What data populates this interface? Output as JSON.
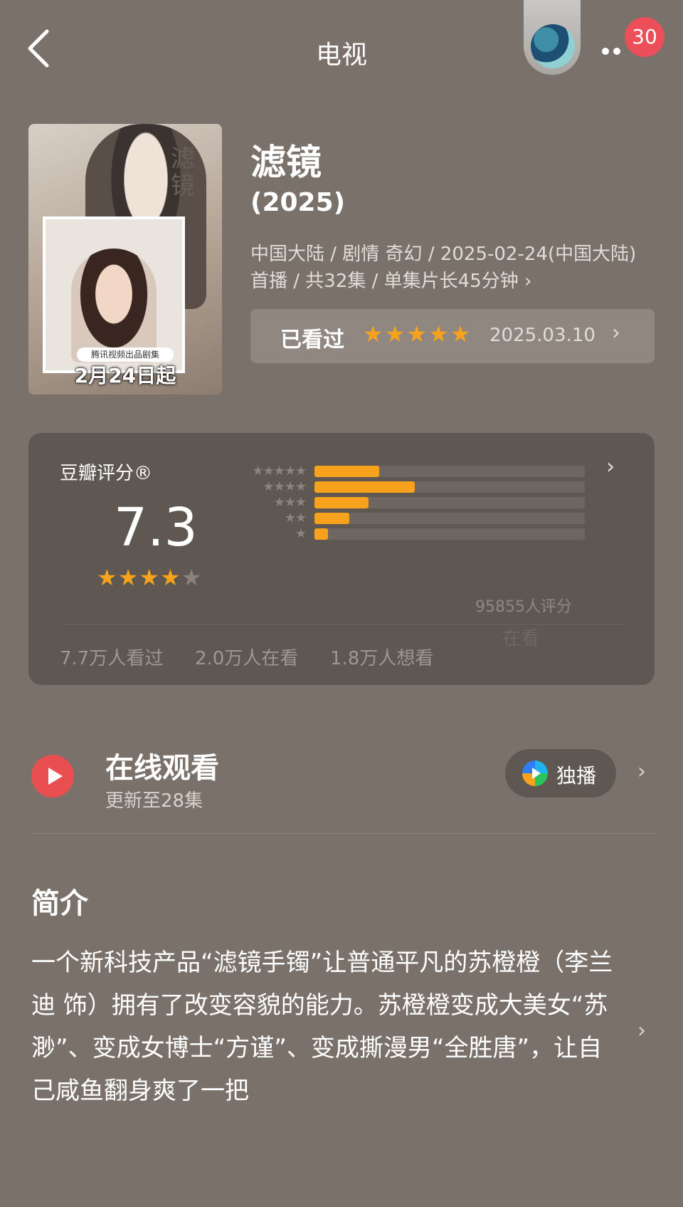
{
  "header": {
    "title": "电视",
    "notification_count": "30"
  },
  "poster": {
    "vertical_title": "滤镜",
    "producer_tag": "腾讯视频出品剧集",
    "date_tag": "2月24日起"
  },
  "show": {
    "title": "滤镜",
    "year": "(2025)",
    "meta": "中国大陆 / 剧情 奇幻 / 2025-02-24(中国大陆)首播 / 共32集 / 单集片长45分钟 ›"
  },
  "watched": {
    "label": "已看过",
    "stars": "★★★★★",
    "user_rating": 5,
    "date": "2025.03.10",
    "chevron": "›"
  },
  "rating": {
    "title": "豆瓣评分®",
    "score": "7.3",
    "star_value": 3.5,
    "count": "95855人评分",
    "distribution": [
      {
        "stars": "★★★★★",
        "fraction": 0.24
      },
      {
        "stars": "★★★★",
        "fraction": 0.37
      },
      {
        "stars": "★★★",
        "fraction": 0.2
      },
      {
        "stars": "★★",
        "fraction": 0.13
      },
      {
        "stars": "★",
        "fraction": 0.05
      }
    ],
    "stats": {
      "watched": "7.7万人看过",
      "watching": "2.0万人在看",
      "want": "1.8万人想看"
    },
    "watermark": "在看"
  },
  "online": {
    "title": "在线观看",
    "subtitle": "更新至28集",
    "platform_label": "独播"
  },
  "synopsis": {
    "title": "简介",
    "body": "一个新科技产品“滤镜手镯”让普通平凡的苏橙橙（李兰迪 饰）拥有了改变容貌的能力。苏橙橙变成大美女“苏渺”、变成女博士“方谨”、变成撕漫男“全胜唐”，让自己咸鱼翻身爽了一把"
  },
  "colors": {
    "background": "#7a716a",
    "accent_star": "#f6a21c",
    "badge_red": "#ec4f5a",
    "card": "#5e5752"
  }
}
